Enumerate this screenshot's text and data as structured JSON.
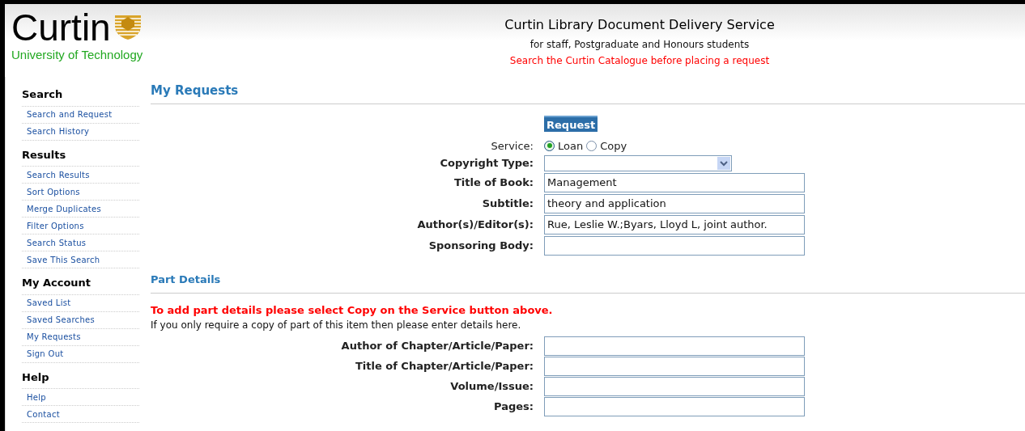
{
  "header": {
    "logo": {
      "wordmark": "Curtin",
      "tagline": "University of Technology"
    },
    "title": "Curtin Library Document Delivery Service",
    "subtitle": "for staff, Postgraduate and Honours students",
    "notice": "Search the Curtin Catalogue before placing a request"
  },
  "sidebar": {
    "sections": [
      {
        "heading": "Search",
        "items": [
          "Search and Request",
          "Search History"
        ]
      },
      {
        "heading": "Results",
        "items": [
          "Search Results",
          "Sort Options",
          "Merge Duplicates",
          "Filter Options",
          "Search Status",
          "Save This Search"
        ]
      },
      {
        "heading": "My Account",
        "items": [
          "Saved List",
          "Saved Searches",
          "My Requests",
          "Sign Out"
        ]
      },
      {
        "heading": "Help",
        "items": [
          "Help",
          "Contact"
        ]
      }
    ]
  },
  "request": {
    "heading": "My Requests",
    "button": "Request",
    "fields": [
      {
        "kind": "radio",
        "label": "Service:",
        "options": [
          {
            "label": "Loan",
            "selected": true
          },
          {
            "label": "Copy",
            "selected": false
          }
        ]
      },
      {
        "kind": "select",
        "label": "Copyright Type:"
      },
      {
        "kind": "text",
        "label": "Title of Book:",
        "value": "Management"
      },
      {
        "kind": "text",
        "label": "Subtitle:",
        "value": "theory and application"
      },
      {
        "kind": "text",
        "label": "Author(s)/Editor(s):",
        "value": "Rue, Leslie W.;Byars, Lloyd L, joint author."
      },
      {
        "kind": "text",
        "label": "Sponsoring Body:"
      }
    ]
  },
  "part_details": {
    "heading": "Part Details",
    "warning": "To add part details please select Copy on the Service button above.",
    "note": "If you only require a copy of part of this item then please enter details here.",
    "fields": [
      {
        "kind": "text",
        "label": "Author of Chapter/Article/Paper:"
      },
      {
        "kind": "text",
        "label": "Title of Chapter/Article/Paper:"
      },
      {
        "kind": "text",
        "label": "Volume/Issue:"
      },
      {
        "kind": "text",
        "label": "Pages:"
      }
    ]
  }
}
